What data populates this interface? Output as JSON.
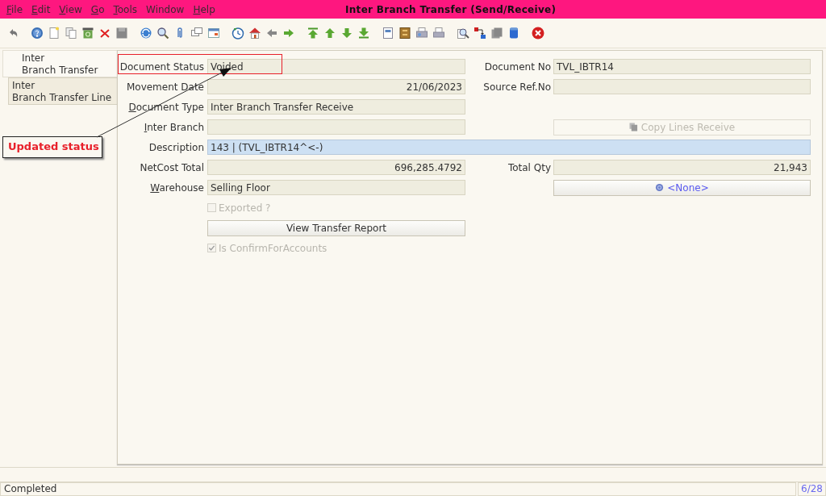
{
  "window": {
    "title": "Inter Branch Transfer (Send/Receive)"
  },
  "menu": [
    {
      "label": "File",
      "underline_first": true
    },
    {
      "label": "Edit",
      "underline_first": true
    },
    {
      "label": "View",
      "underline_first": true
    },
    {
      "label": "Go",
      "underline_first": true
    },
    {
      "label": "Tools",
      "underline_first": true
    },
    {
      "label": "Window",
      "underline_first": false
    },
    {
      "label": "Help",
      "underline_first": true
    }
  ],
  "tabs": [
    {
      "label": "Inter\nBranch Transfer",
      "selected": true
    },
    {
      "label": "Inter\nBranch Transfer Line",
      "selected": false
    }
  ],
  "form": {
    "rows": [
      {
        "left": {
          "kind": "field",
          "label": "Document Status",
          "value": "Voided",
          "editable": false
        },
        "right": {
          "kind": "field",
          "label": "Document No",
          "value": "TVL_IBTR14",
          "editable": false
        }
      },
      {
        "left": {
          "kind": "numeric_field",
          "label": "Movement Date",
          "value": "21/06/2023",
          "editable": false
        },
        "right": {
          "kind": "field",
          "label": "Source Ref.No",
          "editable": false
        }
      },
      {
        "left": {
          "kind": "field",
          "label": "Document Type",
          "value": "Inter Branch Transfer Receive",
          "editable": false,
          "underline_first": true
        }
      },
      {
        "left": {
          "kind": "field",
          "label": "Inter Branch",
          "editable": false,
          "underline_first": true
        },
        "right": {
          "kind": "copy_button",
          "label": "Copy Lines Receive",
          "disabled": true
        }
      },
      {
        "wide": {
          "kind": "field",
          "label": "Description",
          "value": "143 | (TVL_IBTR14^<-)",
          "editable": true
        }
      },
      {
        "left": {
          "kind": "numeric_field",
          "label": "NetCost Total",
          "value": "696,285.4792",
          "editable": false
        },
        "right": {
          "kind": "numeric_field",
          "label": "Total Qty",
          "value": "21,943",
          "editable": false
        }
      },
      {
        "left": {
          "kind": "field",
          "label": "Warehouse",
          "value": "Selling Floor",
          "editable": false,
          "underline_first": true
        },
        "right": {
          "kind": "lookup_button",
          "label": "<None>",
          "disabled": false
        }
      },
      {
        "left": {
          "kind": "checkbox",
          "label": "Exported ?",
          "checked": false,
          "disabled": true
        }
      },
      {
        "left": {
          "kind": "button",
          "label": "View Transfer Report",
          "disabled": false
        }
      },
      {
        "left": {
          "kind": "checkbox",
          "label": "Is ConfirmForAccounts",
          "checked": true,
          "disabled": true
        }
      }
    ]
  },
  "annotation": {
    "text": "Updated status",
    "highlight_box": true
  },
  "status_bar": {
    "message": "Completed",
    "record": "6/28"
  }
}
